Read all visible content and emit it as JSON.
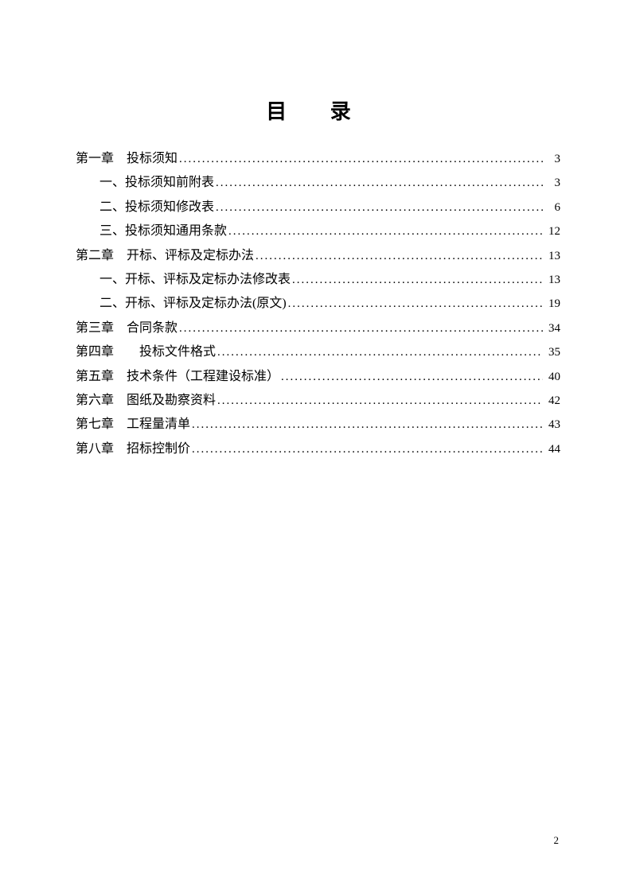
{
  "title": "目 录",
  "toc": [
    {
      "level": 1,
      "text": "第一章 投标须知",
      "page": "3"
    },
    {
      "level": 2,
      "text": "一、投标须知前附表",
      "page": "3"
    },
    {
      "level": 2,
      "text": "二、投标须知修改表",
      "page": "6"
    },
    {
      "level": 2,
      "text": "三、投标须知通用条款",
      "page": "12"
    },
    {
      "level": 1,
      "text": "第二章 开标、评标及定标办法",
      "page": "13"
    },
    {
      "level": 2,
      "text": "一、开标、评标及定标办法修改表",
      "page": "13"
    },
    {
      "level": 2,
      "text": "二、开标、评标及定标办法(原文)",
      "page": "19"
    },
    {
      "level": 1,
      "text": "第三章 合同条款",
      "page": "34"
    },
    {
      "level": 1,
      "text": "第四章  投标文件格式 ",
      "page": "35"
    },
    {
      "level": 1,
      "text": "第五章 技术条件（工程建设标准）",
      "page": "40"
    },
    {
      "level": 1,
      "text": "第六章 图纸及勘察资料 ",
      "page": "42"
    },
    {
      "level": 1,
      "text": "第七章 工程量清单 ",
      "page": "43"
    },
    {
      "level": 1,
      "text": "第八章 招标控制价 ",
      "page": "44"
    }
  ],
  "page_number": "2"
}
